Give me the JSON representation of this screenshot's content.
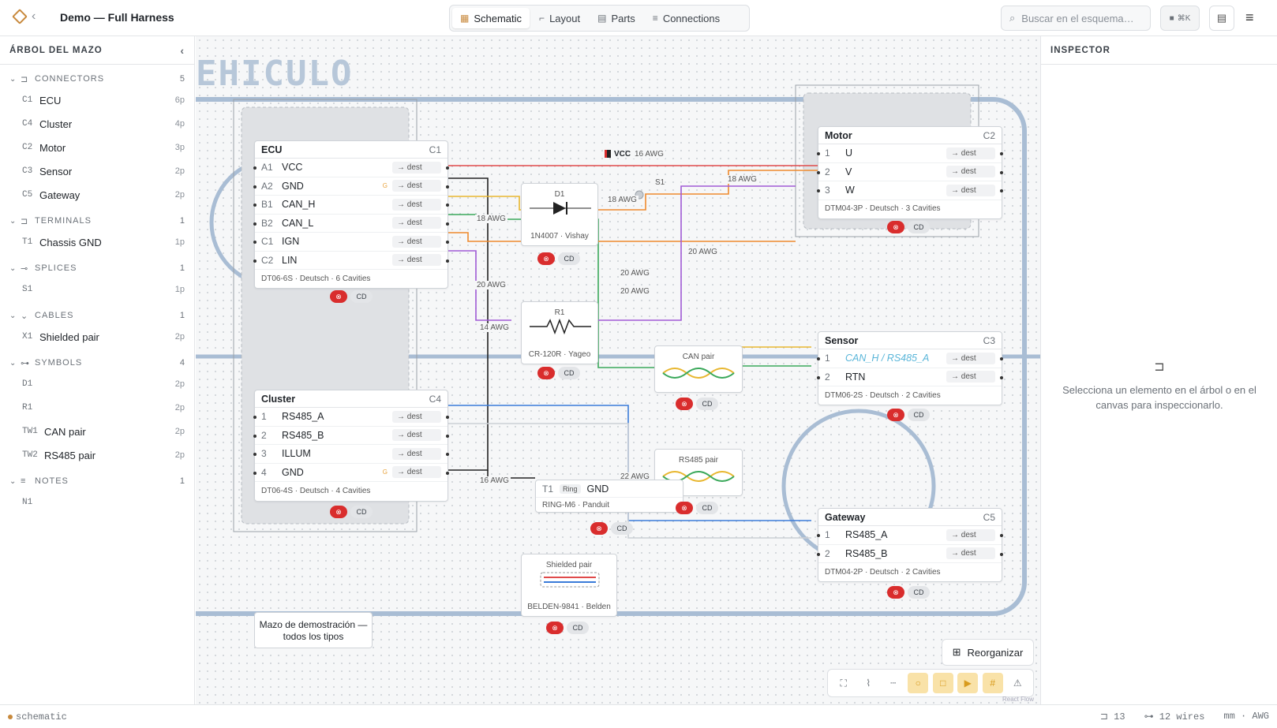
{
  "header": {
    "title": "Demo — Full Harness",
    "tabs": [
      {
        "label": "Schematic",
        "icon": "schematic-icon",
        "active": true
      },
      {
        "label": "Layout",
        "icon": "layout-icon"
      },
      {
        "label": "Parts",
        "icon": "parts-icon"
      },
      {
        "label": "Connections",
        "icon": "connections-icon"
      }
    ],
    "search_placeholder": "Buscar en el esquema…",
    "shortcut": "⌘K"
  },
  "sidebar": {
    "title": "ÁRBOL DEL MAZO",
    "sections": [
      {
        "name": "CONNECTORS",
        "count": "5",
        "items": [
          {
            "ref": "C1",
            "label": "ECU",
            "pins": "6p"
          },
          {
            "ref": "C4",
            "label": "Cluster",
            "pins": "4p"
          },
          {
            "ref": "C2",
            "label": "Motor",
            "pins": "3p"
          },
          {
            "ref": "C3",
            "label": "Sensor",
            "pins": "2p"
          },
          {
            "ref": "C5",
            "label": "Gateway",
            "pins": "2p"
          }
        ]
      },
      {
        "name": "TERMINALS",
        "count": "1",
        "items": [
          {
            "ref": "T1",
            "label": "Chassis GND",
            "pins": "1p"
          }
        ]
      },
      {
        "name": "SPLICES",
        "count": "1",
        "items": [
          {
            "ref": "S1",
            "label": "",
            "pins": "1p"
          }
        ]
      },
      {
        "name": "CABLES",
        "count": "1",
        "items": [
          {
            "ref": "X1",
            "label": "Shielded pair",
            "pins": "2p"
          }
        ]
      },
      {
        "name": "SYMBOLS",
        "count": "4",
        "items": [
          {
            "ref": "D1",
            "label": "",
            "pins": "2p"
          },
          {
            "ref": "R1",
            "label": "",
            "pins": "2p"
          },
          {
            "ref": "TW1",
            "label": "CAN pair",
            "pins": "2p"
          },
          {
            "ref": "TW2",
            "label": "RS485 pair",
            "pins": "2p"
          }
        ]
      },
      {
        "name": "NOTES",
        "count": "1",
        "items": [
          {
            "ref": "N1",
            "label": "",
            "pins": ""
          }
        ]
      }
    ]
  },
  "canvas": {
    "group_label": "EHICULO",
    "ecu": {
      "name": "ECU",
      "ref": "C1",
      "rows": [
        {
          "pin": "A1",
          "sig": "VCC"
        },
        {
          "pin": "A2",
          "sig": "GND",
          "g": "G"
        },
        {
          "pin": "B1",
          "sig": "CAN_H"
        },
        {
          "pin": "B2",
          "sig": "CAN_L"
        },
        {
          "pin": "C1",
          "sig": "IGN"
        },
        {
          "pin": "C2",
          "sig": "LIN"
        }
      ],
      "footer": "DT06-6S · Deutsch · 6 Cavities"
    },
    "cluster": {
      "name": "Cluster",
      "ref": "C4",
      "rows": [
        {
          "pin": "1",
          "sig": "RS485_A"
        },
        {
          "pin": "2",
          "sig": "RS485_B"
        },
        {
          "pin": "3",
          "sig": "ILLUM"
        },
        {
          "pin": "4",
          "sig": "GND",
          "g": "G"
        }
      ],
      "footer": "DT06-4S · Deutsch · 4 Cavities"
    },
    "motor": {
      "name": "Motor",
      "ref": "C2",
      "rows": [
        {
          "pin": "1",
          "sig": "U"
        },
        {
          "pin": "2",
          "sig": "V"
        },
        {
          "pin": "3",
          "sig": "W"
        }
      ],
      "footer": "DTM04-3P · Deutsch · 3 Cavities"
    },
    "sensor": {
      "name": "Sensor",
      "ref": "C3",
      "rows": [
        {
          "pin": "1",
          "sig": "CAN_H / RS485_A",
          "link": true
        },
        {
          "pin": "2",
          "sig": "RTN"
        }
      ],
      "footer": "DTM06-2S · Deutsch · 2 Cavities"
    },
    "gateway": {
      "name": "Gateway",
      "ref": "C5",
      "rows": [
        {
          "pin": "1",
          "sig": "RS485_A"
        },
        {
          "pin": "2",
          "sig": "RS485_B"
        }
      ],
      "footer": "DTM04-2P · Deutsch · 2 Cavities"
    },
    "dest": "→ dest",
    "d1": {
      "ref": "D1",
      "part": "1N4007 · Vishay"
    },
    "r1": {
      "ref": "R1",
      "part": "CR-120R · Yageo"
    },
    "can": {
      "label": "CAN pair"
    },
    "rs485": {
      "label": "RS485 pair"
    },
    "shielded": {
      "label": "Shielded pair",
      "part": "BELDEN-9841 · Belden"
    },
    "terminal": {
      "ref": "T1",
      "tag": "Ring",
      "sig": "GND",
      "part": "RING-M6 · Panduit"
    },
    "splice": "S1",
    "vcc": "VCC",
    "badge": {
      "cd": "CD"
    },
    "awg": [
      "16 AWG",
      "18 AWG",
      "18 AWG",
      "18 AWG",
      "20 AWG",
      "20 AWG",
      "20 AWG",
      "20 AWG",
      "14 AWG",
      "22 AWG",
      "16 AWG"
    ],
    "note": "Mazo de demostración — todos los tipos",
    "reorganize": "Reorganizar",
    "watermark": "React Flow"
  },
  "inspector": {
    "title": "INSPECTOR",
    "empty": "Selecciona un elemento en el árbol o en el canvas para inspeccionarlo."
  },
  "status": {
    "mode": "schematic",
    "connectors": "13",
    "wires": "12 wires",
    "units": "mm · AWG"
  },
  "colors": {
    "accent": "#c8893c",
    "red_wire": "#e04a4a",
    "orange_wire": "#ee8a2e",
    "yellow_wire": "#e8b730",
    "green_wire": "#3aa85a",
    "purple_wire": "#a05ad6",
    "blue_wire": "#3a7bd9",
    "group_blue": "#a9bdd4"
  }
}
